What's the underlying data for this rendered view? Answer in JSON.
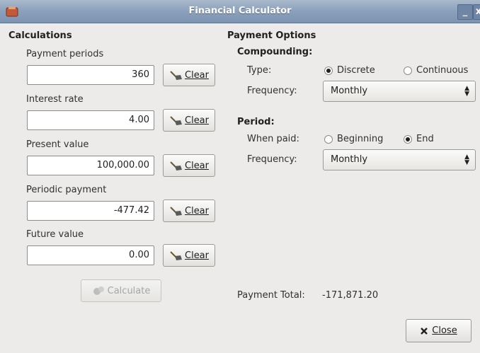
{
  "window": {
    "title": "Financial Calculator",
    "minimize_label": "_",
    "close_label": "x"
  },
  "calculations": {
    "heading": "Calculations",
    "fields": [
      {
        "label": "Payment periods",
        "value": "360",
        "clear": "Clear"
      },
      {
        "label": "Interest rate",
        "value": "4.00",
        "clear": "Clear"
      },
      {
        "label": "Present value",
        "value": "100,000.00",
        "clear": "Clear"
      },
      {
        "label": "Periodic payment",
        "value": "-477.42",
        "clear": "Clear"
      },
      {
        "label": "Future value",
        "value": "0.00",
        "clear": "Clear"
      }
    ],
    "calculate_label": "Calculate"
  },
  "payment_options": {
    "heading": "Payment Options",
    "compounding": {
      "heading": "Compounding:",
      "type_label": "Type:",
      "type_options": [
        {
          "label": "Discrete",
          "selected": true
        },
        {
          "label": "Continuous",
          "selected": false
        }
      ],
      "frequency_label": "Frequency:",
      "frequency_value": "Monthly"
    },
    "period": {
      "heading": "Period:",
      "when_paid_label": "When paid:",
      "when_paid_options": [
        {
          "label": "Beginning",
          "selected": false
        },
        {
          "label": "End",
          "selected": true
        }
      ],
      "frequency_label": "Frequency:",
      "frequency_value": "Monthly"
    },
    "total_label": "Payment Total:",
    "total_value": "-171,871.20"
  },
  "close_button_label": "Close",
  "icons": [
    "app-icon",
    "broom-icon",
    "calculate-icon",
    "close-x-icon",
    "combo-arrows-icon"
  ]
}
